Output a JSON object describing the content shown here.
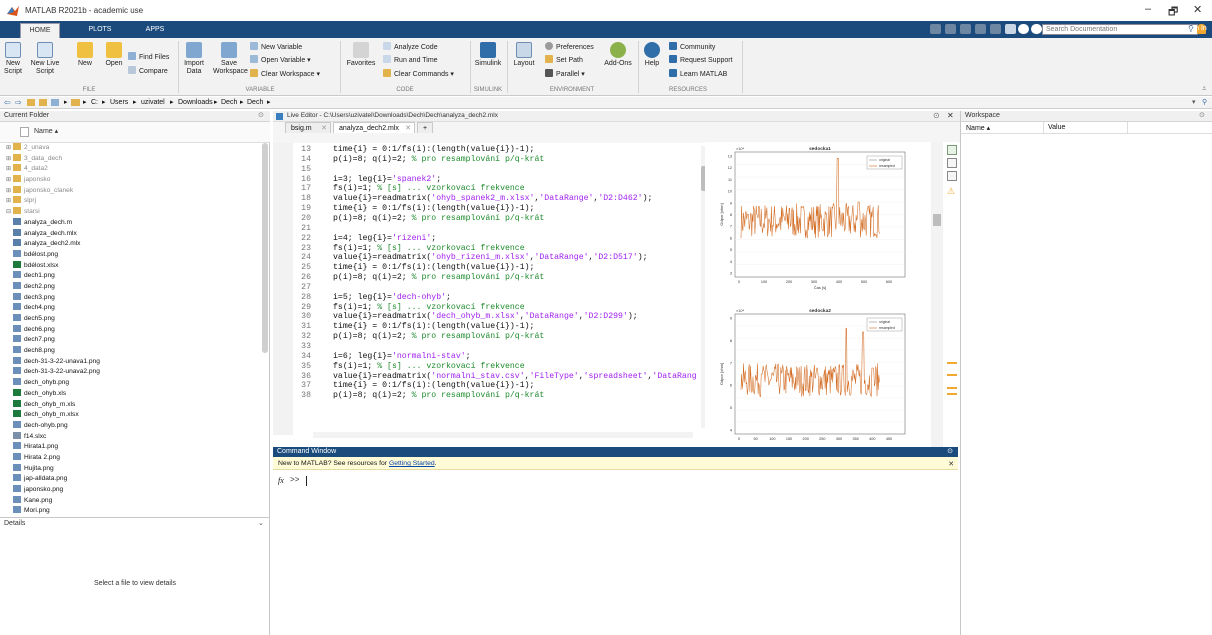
{
  "window": {
    "title": "MATLAB R2021b - academic use",
    "minimize": "–",
    "maximize": "🗗",
    "close": "✕"
  },
  "tabs": [
    {
      "label": "HOME"
    },
    {
      "label": "PLOTS"
    },
    {
      "label": "APPS"
    }
  ],
  "search": {
    "placeholder": "Search Documentation",
    "signin": "Sign In"
  },
  "ribbon": {
    "new_script": "New Script",
    "new_live_script": "New Live Script",
    "new": "New",
    "open": "Open",
    "find_files": "Find Files",
    "compare": "Compare",
    "import_data": "Import Data",
    "save_workspace": "Save Workspace",
    "new_variable": "New Variable",
    "open_variable": "Open Variable ▾",
    "clear_workspace": "Clear Workspace ▾",
    "favorites": "Favorites",
    "analyze_code": "Analyze Code",
    "run_and_time": "Run and Time",
    "clear_commands": "Clear Commands ▾",
    "simulink": "Simulink",
    "layout": "Layout",
    "preferences": "Preferences",
    "set_path": "Set Path",
    "parallel": "Parallel ▾",
    "add_ons": "Add-Ons",
    "help": "Help",
    "community": "Community",
    "request_support": "Request Support",
    "learn_matlab": "Learn MATLAB",
    "groups": {
      "file": "FILE",
      "variable": "VARIABLE",
      "code": "CODE",
      "simulink": "SIMULINK",
      "environment": "ENVIRONMENT",
      "resources": "RESOURCES"
    }
  },
  "address": {
    "path": [
      "C:",
      "Users",
      "uzivatel",
      "Downloads",
      "Dech",
      "Dech"
    ]
  },
  "folder": {
    "title": "Current Folder",
    "col": "Name ▴",
    "items": [
      {
        "name": "2_unava",
        "type": "folder",
        "dim": true
      },
      {
        "name": "3_data_dech",
        "type": "folder",
        "dim": true
      },
      {
        "name": "4_data2",
        "type": "folder",
        "dim": true
      },
      {
        "name": "japonsko",
        "type": "folder",
        "dim": true
      },
      {
        "name": "japonsko_clanek",
        "type": "folder",
        "dim": true
      },
      {
        "name": "slprj",
        "type": "folder",
        "dim": true
      },
      {
        "name": "starsi",
        "type": "folder",
        "dim": true
      },
      {
        "name": "analyza_dech.m",
        "type": "m"
      },
      {
        "name": "analyza_dech.mlx",
        "type": "mlx"
      },
      {
        "name": "analyza_dech2.mlx",
        "type": "mlx"
      },
      {
        "name": "bdélost.png",
        "type": "png"
      },
      {
        "name": "bdélost.xlsx",
        "type": "xlsx"
      },
      {
        "name": "dech1.png",
        "type": "png"
      },
      {
        "name": "dech2.png",
        "type": "png"
      },
      {
        "name": "dech3.png",
        "type": "png"
      },
      {
        "name": "dech4.png",
        "type": "png"
      },
      {
        "name": "dech5.png",
        "type": "png"
      },
      {
        "name": "dech6.png",
        "type": "png"
      },
      {
        "name": "dech7.png",
        "type": "png"
      },
      {
        "name": "dech8.png",
        "type": "png"
      },
      {
        "name": "dech-31-3-22-unava1.png",
        "type": "png"
      },
      {
        "name": "dech-31-3-22-unava2.png",
        "type": "png"
      },
      {
        "name": "dech_ohyb.png",
        "type": "png"
      },
      {
        "name": "dech_ohyb.xls",
        "type": "xls"
      },
      {
        "name": "dech_ohyb_m.xls",
        "type": "xls"
      },
      {
        "name": "dech_ohyb_m.xlsx",
        "type": "xlsx"
      },
      {
        "name": "dech-ohyb.png",
        "type": "png"
      },
      {
        "name": "f14.slxc",
        "type": "slxc"
      },
      {
        "name": "Hirata1.png",
        "type": "png"
      },
      {
        "name": "Hirata 2.png",
        "type": "png"
      },
      {
        "name": "Hujita.png",
        "type": "png"
      },
      {
        "name": "jap-alldata.png",
        "type": "png"
      },
      {
        "name": "japonsko.png",
        "type": "png"
      },
      {
        "name": "Kane.png",
        "type": "png"
      },
      {
        "name": "Mori.png",
        "type": "png"
      }
    ]
  },
  "details": {
    "title": "Details",
    "empty": "Select a file to view details"
  },
  "editor": {
    "title": "Live Editor - C:\\Users\\uzivatel\\Downloads\\Dech\\Dech\\analyza_dech2.mlx",
    "tabs": [
      {
        "label": "bsig.m"
      },
      {
        "label": "analyza_dech2.mlx"
      },
      {
        "label": "+"
      }
    ],
    "lines": [
      {
        "n": "13",
        "segs": [
          {
            "t": "time{i} = 0:1/fs(i):(length(value{i})-1);",
            "c": ""
          }
        ]
      },
      {
        "n": "14",
        "segs": [
          {
            "t": "p(i)=8; q(i)=2; ",
            "c": ""
          },
          {
            "t": "% pro resamplování p/q-krát",
            "c": "cm"
          }
        ]
      },
      {
        "n": "15",
        "segs": [
          {
            "t": "",
            "c": ""
          }
        ]
      },
      {
        "n": "16",
        "segs": [
          {
            "t": "i=3; leg{i}=",
            "c": ""
          },
          {
            "t": "'spanek2'",
            "c": "st"
          },
          {
            "t": ";",
            "c": ""
          }
        ]
      },
      {
        "n": "17",
        "segs": [
          {
            "t": "fs(i)=1; ",
            "c": ""
          },
          {
            "t": "% [s] ... vzorkovací frekvence",
            "c": "cm"
          }
        ]
      },
      {
        "n": "18",
        "segs": [
          {
            "t": "value{i}=readmatrix(",
            "c": ""
          },
          {
            "t": "'ohyb_spanek2_m.xlsx'",
            "c": "st"
          },
          {
            "t": ",",
            "c": ""
          },
          {
            "t": "'DataRange'",
            "c": "st"
          },
          {
            "t": ",",
            "c": ""
          },
          {
            "t": "'D2:D462'",
            "c": "st"
          },
          {
            "t": ");",
            "c": ""
          }
        ]
      },
      {
        "n": "19",
        "segs": [
          {
            "t": "time{i} = 0:1/fs(i):(length(value{i})-1);",
            "c": ""
          }
        ]
      },
      {
        "n": "20",
        "segs": [
          {
            "t": "p(i)=8; q(i)=2; ",
            "c": ""
          },
          {
            "t": "% pro resamplování p/q-krát",
            "c": "cm"
          }
        ]
      },
      {
        "n": "21",
        "segs": [
          {
            "t": "",
            "c": ""
          }
        ]
      },
      {
        "n": "22",
        "segs": [
          {
            "t": "i=4; leg{i}=",
            "c": ""
          },
          {
            "t": "'rizeni'",
            "c": "st"
          },
          {
            "t": ";",
            "c": ""
          }
        ]
      },
      {
        "n": "23",
        "segs": [
          {
            "t": "fs(i)=1; ",
            "c": ""
          },
          {
            "t": "% [s] ... vzorkovací frekvence",
            "c": "cm"
          }
        ]
      },
      {
        "n": "24",
        "segs": [
          {
            "t": "value{i}=readmatrix(",
            "c": ""
          },
          {
            "t": "'ohyb_rizeni_m.xlsx'",
            "c": "st"
          },
          {
            "t": ",",
            "c": ""
          },
          {
            "t": "'DataRange'",
            "c": "st"
          },
          {
            "t": ",",
            "c": ""
          },
          {
            "t": "'D2:D517'",
            "c": "st"
          },
          {
            "t": ");",
            "c": ""
          }
        ]
      },
      {
        "n": "25",
        "segs": [
          {
            "t": "time{i} = 0:1/fs(i):(length(value{i})-1);",
            "c": ""
          }
        ]
      },
      {
        "n": "26",
        "segs": [
          {
            "t": "p(i)=8; q(i)=2; ",
            "c": ""
          },
          {
            "t": "% pro resamplování p/q-krát",
            "c": "cm"
          }
        ]
      },
      {
        "n": "27",
        "segs": [
          {
            "t": "",
            "c": ""
          }
        ]
      },
      {
        "n": "28",
        "segs": [
          {
            "t": "i=5; leg{i}=",
            "c": ""
          },
          {
            "t": "'dech-ohyb'",
            "c": "st"
          },
          {
            "t": ";",
            "c": ""
          }
        ]
      },
      {
        "n": "29",
        "segs": [
          {
            "t": "fs(i)=1; ",
            "c": ""
          },
          {
            "t": "% [s] ... vzorkovací frekvence",
            "c": "cm"
          }
        ]
      },
      {
        "n": "30",
        "segs": [
          {
            "t": "value{i}=readmatrix(",
            "c": ""
          },
          {
            "t": "'dech_ohyb_m.xlsx'",
            "c": "st"
          },
          {
            "t": ",",
            "c": ""
          },
          {
            "t": "'DataRange'",
            "c": "st"
          },
          {
            "t": ",",
            "c": ""
          },
          {
            "t": "'D2:D299'",
            "c": "st"
          },
          {
            "t": ");",
            "c": ""
          }
        ]
      },
      {
        "n": "31",
        "segs": [
          {
            "t": "time{i} = 0:1/fs(i):(length(value{i})-1);",
            "c": ""
          }
        ]
      },
      {
        "n": "32",
        "segs": [
          {
            "t": "p(i)=8; q(i)=2; ",
            "c": ""
          },
          {
            "t": "% pro resamplování p/q-krát",
            "c": "cm"
          }
        ]
      },
      {
        "n": "33",
        "segs": [
          {
            "t": "",
            "c": ""
          }
        ]
      },
      {
        "n": "34",
        "segs": [
          {
            "t": "i=6; leg{i}=",
            "c": ""
          },
          {
            "t": "'normalni-stav'",
            "c": "st"
          },
          {
            "t": ";",
            "c": ""
          }
        ]
      },
      {
        "n": "35",
        "segs": [
          {
            "t": "fs(i)=1; ",
            "c": ""
          },
          {
            "t": "% [s] ... vzorkovací frekvence",
            "c": "cm"
          }
        ]
      },
      {
        "n": "36",
        "segs": [
          {
            "t": "value{i}=readmatrix(",
            "c": ""
          },
          {
            "t": "'normalni_stav.csv'",
            "c": "st"
          },
          {
            "t": ",",
            "c": ""
          },
          {
            "t": "'FileType'",
            "c": "st"
          },
          {
            "t": ",",
            "c": ""
          },
          {
            "t": "'spreadsheet'",
            "c": "st"
          },
          {
            "t": ",",
            "c": ""
          },
          {
            "t": "'DataRang",
            "c": "st"
          }
        ]
      },
      {
        "n": "37",
        "segs": [
          {
            "t": "time{i} = 0:1/fs(i):(length(value{i})-1);",
            "c": ""
          }
        ]
      },
      {
        "n": "38",
        "segs": [
          {
            "t": "p(i)=8; q(i)=2; ",
            "c": ""
          },
          {
            "t": "% pro resamplování p/q-krát",
            "c": "cm"
          }
        ]
      }
    ]
  },
  "plots": [
    {
      "title": "sedocka1",
      "legend": [
        "original",
        "resampled"
      ],
      "xlabel": "Čas [s]",
      "ylabel": "Odpor [ohm]",
      "exp": "×10⁴",
      "yticks": [
        "13",
        "12",
        "11",
        "10",
        "9",
        "8",
        "7",
        "6",
        "5",
        "4",
        "3"
      ],
      "xticks": [
        "0",
        "100",
        "200",
        "300",
        "400",
        "500",
        "600"
      ]
    },
    {
      "title": "sedocka2",
      "legend": [
        "original",
        "resampled"
      ],
      "xlabel": "",
      "ylabel": "Odpor [ohm]",
      "exp": "×10⁴",
      "yticks": [
        "9",
        "8",
        "7",
        "6",
        "5",
        "4"
      ],
      "xticks": [
        "0",
        "50",
        "100",
        "150",
        "200",
        "250",
        "300",
        "350",
        "400",
        "450"
      ]
    }
  ],
  "colors": {
    "signal": "#d2691e",
    "accent": "#1a4b7c",
    "warning": "#f0a830"
  },
  "command": {
    "title": "Command Window",
    "info_prefix": "New to MATLAB? See resources for ",
    "info_link": "Getting Started",
    "info_suffix": ".",
    "prompt_fx": "fx",
    "prompt": ">>"
  },
  "workspace": {
    "title": "Workspace",
    "col_name": "Name ▴",
    "col_value": "Value"
  }
}
